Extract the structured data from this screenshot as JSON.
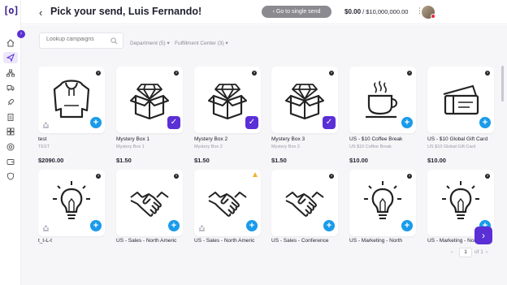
{
  "app": {
    "logo_text": "[o]"
  },
  "header": {
    "back_label": "‹",
    "title": "Pick your send, Luis Fernando!",
    "go_single_label": "‹ Go to single send",
    "balance_main": "$0.00",
    "balance_limit": "/ $10,000,000.00"
  },
  "filters": {
    "search_placeholder": "Lookup campaigns",
    "department": "Department (5) ▾",
    "fulfillment": "Fulfillment Center (3) ▾"
  },
  "cards": [
    {
      "name": "test",
      "sub": "TEST",
      "price": "$2090.00",
      "icon": "hoodie-icon",
      "action": "add",
      "people": true
    },
    {
      "name": "Mystery Box 1",
      "sub": "Mystery Box 1",
      "price": "$1.50",
      "icon": "mystery-box-icon",
      "action": "selected",
      "people": false
    },
    {
      "name": "Mystery Box 2",
      "sub": "Mystery Box 2",
      "price": "$1.50",
      "icon": "mystery-box-icon",
      "action": "selected",
      "people": false
    },
    {
      "name": "Mystery Box 3",
      "sub": "Mystery Box 3",
      "price": "$1.50",
      "icon": "mystery-box-icon",
      "action": "selected",
      "people": false
    },
    {
      "name": "US - $10 Coffee Break",
      "sub": "US $10 Coffee Break",
      "price": "$10.00",
      "icon": "coffee-cup-icon",
      "action": "add",
      "people": false
    },
    {
      "name": "US - $10 Global Gift Card",
      "sub": "US $10 Global Gift Card",
      "price": "$10.00",
      "icon": "gift-card-icon",
      "action": "add",
      "people": false
    },
    {
      "name": "t_t-L-t",
      "sub": "",
      "price": "",
      "icon": "lightbulb-icon",
      "action": "add",
      "people": true
    },
    {
      "name": "US - Sales - North Americ",
      "sub": "",
      "price": "",
      "icon": "handshake-icon",
      "action": "add",
      "people": false
    },
    {
      "name": "US - Sales - North Americ",
      "sub": "",
      "price": "",
      "icon": "handshake-icon",
      "action": "add",
      "people": true,
      "warning": true
    },
    {
      "name": "US - Sales - Conference",
      "sub": "",
      "price": "",
      "icon": "handshake-icon",
      "action": "add",
      "people": false
    },
    {
      "name": "US - Marketing - North",
      "sub": "",
      "price": "",
      "icon": "lightbulb-icon",
      "action": "add",
      "people": false
    },
    {
      "name": "US - Marketing - North",
      "sub": "",
      "price": "",
      "icon": "lightbulb-icon",
      "action": "add",
      "people": false
    }
  ],
  "pagination": {
    "prev": "‹",
    "current": "1",
    "of": "of 1",
    "next": "›"
  },
  "fab_label": "›",
  "colors": {
    "accent": "#5a2fd6",
    "add": "#1a9bea"
  }
}
